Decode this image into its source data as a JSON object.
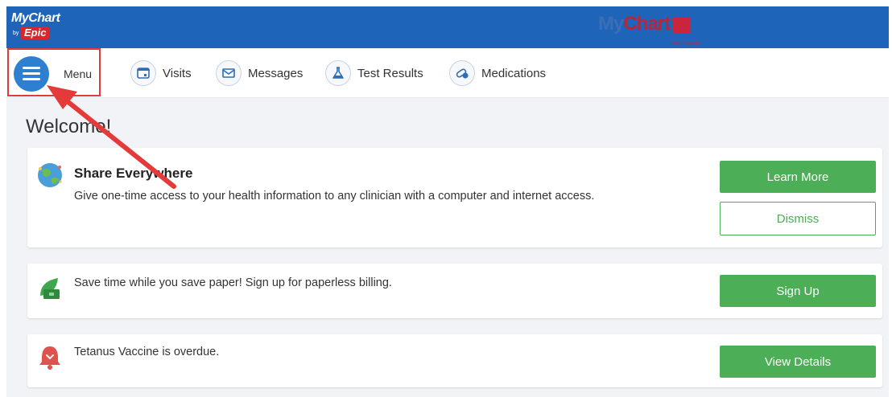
{
  "header": {
    "logo_left_main": "MyChart",
    "logo_left_by": "by",
    "logo_left_epic": "Epic",
    "logo_center_my": "My",
    "logo_center_chart": "Chart",
    "logo_center_sub": "Salem Health"
  },
  "nav": {
    "menu_label": "Menu",
    "items": [
      {
        "label": "Visits",
        "icon": "calendar-icon"
      },
      {
        "label": "Messages",
        "icon": "envelope-icon"
      },
      {
        "label": "Test Results",
        "icon": "flask-icon"
      },
      {
        "label": "Medications",
        "icon": "pills-icon"
      }
    ]
  },
  "main": {
    "welcome": "Welcome!",
    "cards": [
      {
        "icon": "globe-icon",
        "title": "Share Everywhere",
        "text": "Give one-time access to your health information to any clinician with a computer and internet access.",
        "primary_button": "Learn More",
        "secondary_button": "Dismiss"
      },
      {
        "icon": "leaf-money-icon",
        "text": "Save time while you save paper! Sign up for paperless billing.",
        "primary_button": "Sign Up"
      },
      {
        "icon": "bell-icon",
        "text": "Tetanus Vaccine is overdue.",
        "primary_button": "View Details"
      }
    ]
  },
  "colors": {
    "header_bg": "#1e64b8",
    "button_green": "#4cae57",
    "highlight_red": "#e53a3a",
    "menu_blue": "#2f7fd0"
  }
}
